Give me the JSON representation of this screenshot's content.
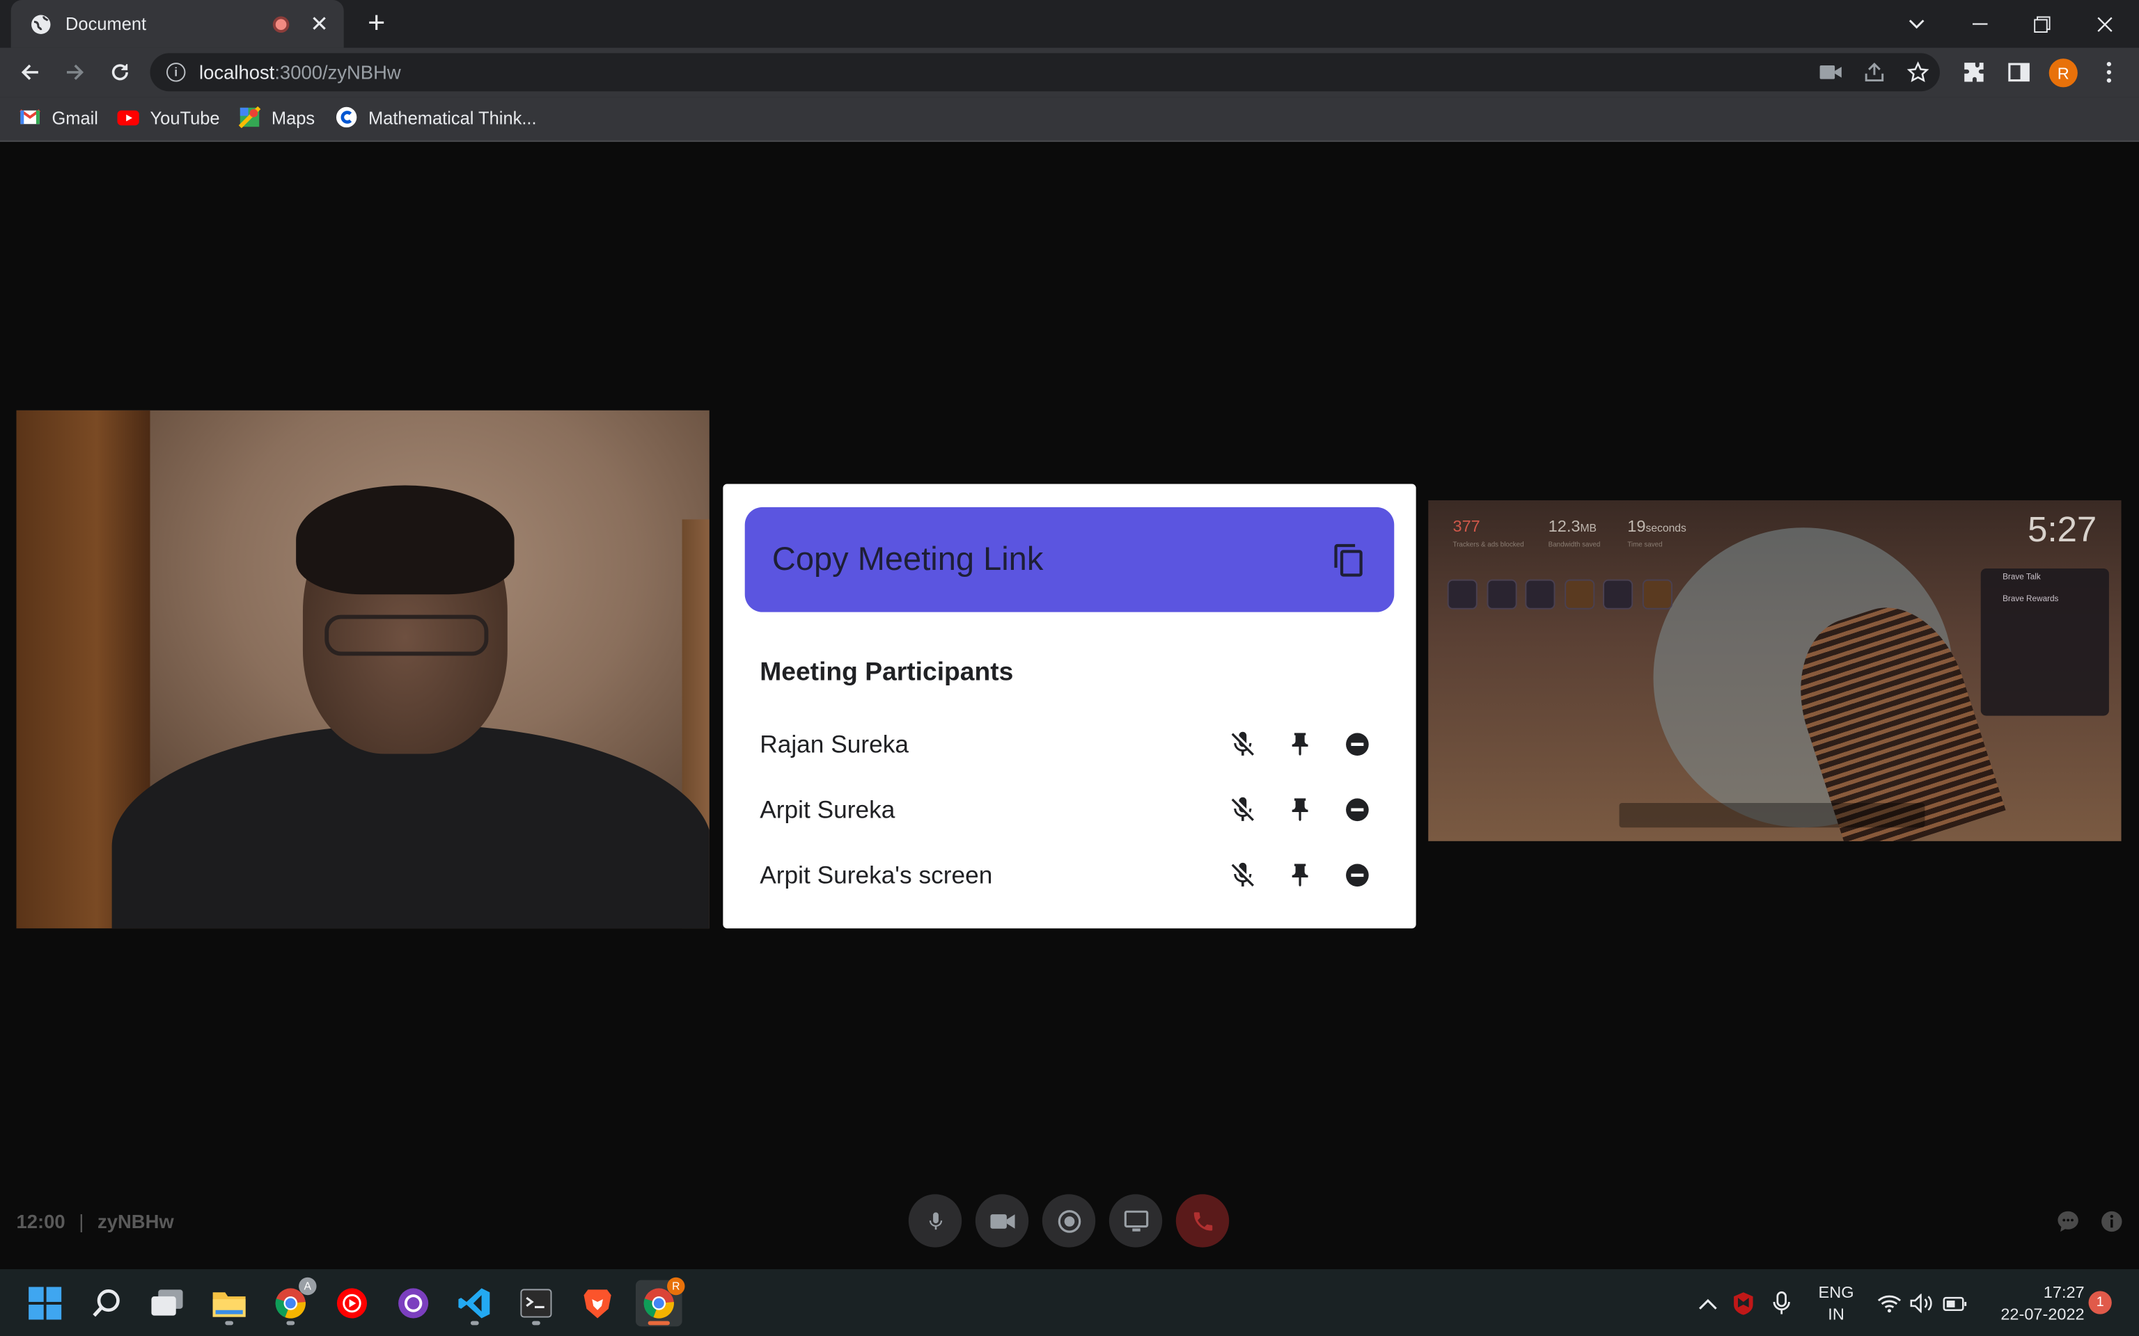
{
  "browser": {
    "tab_title": "Document",
    "close_glyph": "✕",
    "newtab_glyph": "+",
    "url_host": "localhost",
    "url_path": ":3000/zyNBHw",
    "profile_initial": "R",
    "bookmarks": [
      {
        "label": "Gmail",
        "icon": "gmail-icon"
      },
      {
        "label": "YouTube",
        "icon": "youtube-icon"
      },
      {
        "label": "Maps",
        "icon": "maps-icon"
      },
      {
        "label": "Mathematical Think...",
        "icon": "coursera-icon"
      }
    ]
  },
  "modal": {
    "copy_label": "Copy Meeting Link",
    "participants_title": "Meeting Participants",
    "participants": [
      {
        "name": "Rajan Sureka"
      },
      {
        "name": "Arpit Sureka"
      },
      {
        "name": "Arpit Sureka's screen"
      }
    ],
    "accent": "#5b55e0"
  },
  "screen_share": {
    "stat1": "377",
    "stat1_sub": "Trackers & ads blocked",
    "stat2": "12.3",
    "stat2_unit": "MB",
    "stat2_sub": "Bandwidth saved",
    "stat3": "19",
    "stat3_unit": "seconds",
    "stat3_sub": "Time saved",
    "clock": "5:27",
    "card_title": "Brave Talk",
    "card_sub": "Brave Rewards"
  },
  "meeting": {
    "time": "12:00",
    "separator": "|",
    "code": "zyNBHw"
  },
  "taskbar": {
    "lang_top": "ENG",
    "lang_bottom": "IN",
    "time": "17:27",
    "date": "22-07-2022",
    "notifications": "1",
    "chrome_badge_a": "A",
    "chrome_badge_r": "R"
  }
}
